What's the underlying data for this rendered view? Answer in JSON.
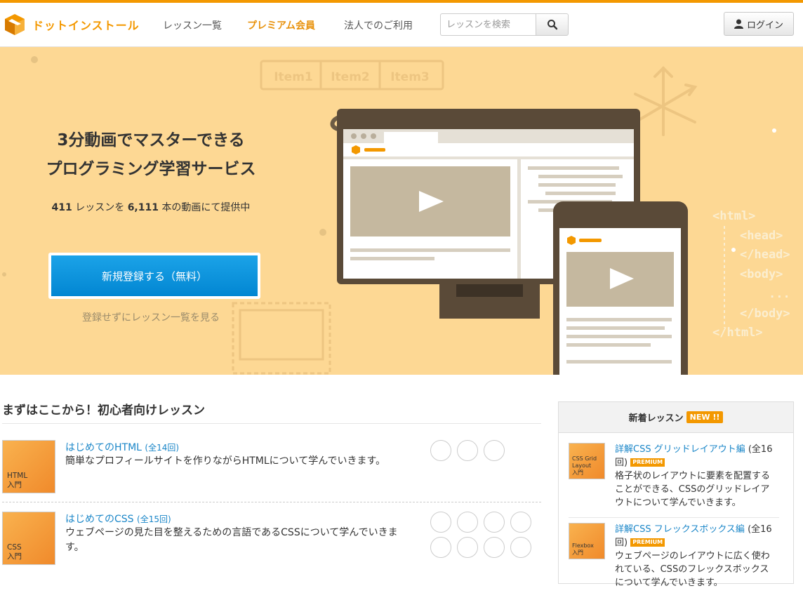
{
  "header": {
    "logo_text": "ドットインストール",
    "nav": {
      "lessons": "レッスン一覧",
      "premium": "プレミアム会員",
      "corporate": "法人でのご利用"
    },
    "search_placeholder": "レッスンを検索",
    "login_label": "ログイン"
  },
  "hero": {
    "title_line1": "3分動画でマスターできる",
    "title_line2": "プログラミング学習サービス",
    "lesson_count": "411",
    "lesson_text": "レッスンを",
    "video_count": "6,111",
    "video_text": "本の動画にて提供中",
    "signup_label": "新規登録する（無料）",
    "browse_label": "登録せずにレッスン一覧を見る",
    "illustration": {
      "items": [
        "Item1",
        "Item2",
        "Item3"
      ],
      "code_lines": [
        "<html>",
        "<head>",
        "</head>",
        "<body>",
        "...",
        "</body>",
        "</html>"
      ]
    }
  },
  "beginner": {
    "section_title": "まずはここから！初心者向けレッスン",
    "courses": [
      {
        "thumb_label": "HTML\n入門",
        "title": "はじめてのHTML",
        "count": "(全14回)",
        "desc": "簡単なプロフィールサイトを作りながらHTMLについて学んでいきます。"
      },
      {
        "thumb_label": "CSS\n入門",
        "title": "はじめてのCSS",
        "count": "(全15回)",
        "desc": "ウェブページの見た目を整えるための言語であるCSSについて学んでいきます。"
      }
    ]
  },
  "new_lessons": {
    "title": "新着レッスン",
    "badge": "NEW !!",
    "items": [
      {
        "thumb_label": "CSS Grid\nLayout\n入門",
        "title": "詳解CSS グリッドレイアウト編",
        "count": "(全16回)",
        "badge": "PREMIUM",
        "desc": "格子状のレイアウトに要素を配置することができる、CSSのグリッドレイアウトについて学んでいきます。"
      },
      {
        "thumb_label": "Flexbox\n入門",
        "title": "詳解CSS フレックスボックス編",
        "count": "(全16回)",
        "badge": "PREMIUM",
        "desc": "ウェブページのレイアウトに広く使われている、CSSのフレックスボックスについて学んでいきます。"
      }
    ]
  },
  "colors": {
    "accent": "#f39800",
    "hero_bg": "#fdd894",
    "link": "#1a86c8",
    "signup": "#0d95de"
  }
}
